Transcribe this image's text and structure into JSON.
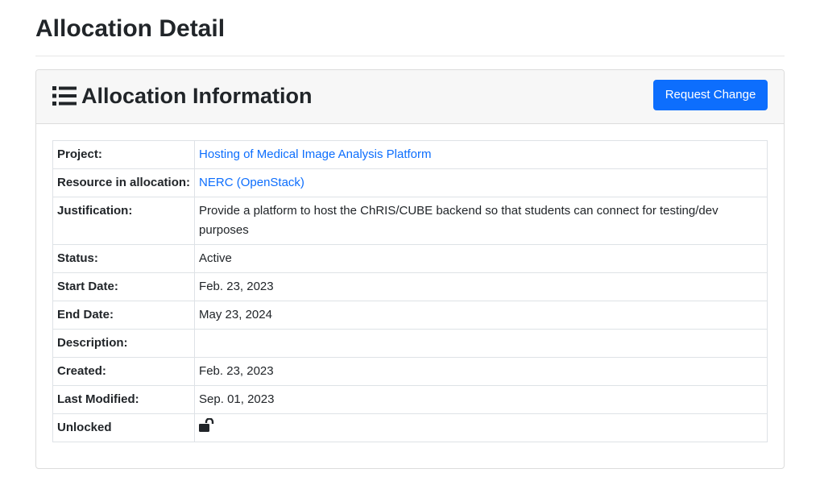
{
  "page": {
    "title": "Allocation Detail"
  },
  "card": {
    "title": "Allocation Information",
    "title_icon": "list-icon",
    "request_change_label": "Request Change"
  },
  "details": {
    "project_label": "Project:",
    "project_value": "Hosting of Medical Image Analysis Platform",
    "resource_label": "Resource in allocation:",
    "resource_value": "NERC (OpenStack)",
    "justification_label": "Justification:",
    "justification_value": "Provide a platform to host the ChRIS/CUBE backend so that students can connect for testing/dev purposes",
    "status_label": "Status:",
    "status_value": "Active",
    "start_date_label": "Start Date:",
    "start_date_value": "Feb. 23, 2023",
    "end_date_label": "End Date:",
    "end_date_value": "May 23, 2024",
    "description_label": "Description:",
    "description_value": "",
    "created_label": "Created:",
    "created_value": "Feb. 23, 2023",
    "last_modified_label": "Last Modified:",
    "last_modified_value": "Sep. 01, 2023",
    "unlocked_label": "Unlocked",
    "unlocked_icon": "unlock-icon"
  },
  "colors": {
    "link": "#0d6efd",
    "button": "#0d6efd",
    "header_bg": "#f7f7f7"
  }
}
